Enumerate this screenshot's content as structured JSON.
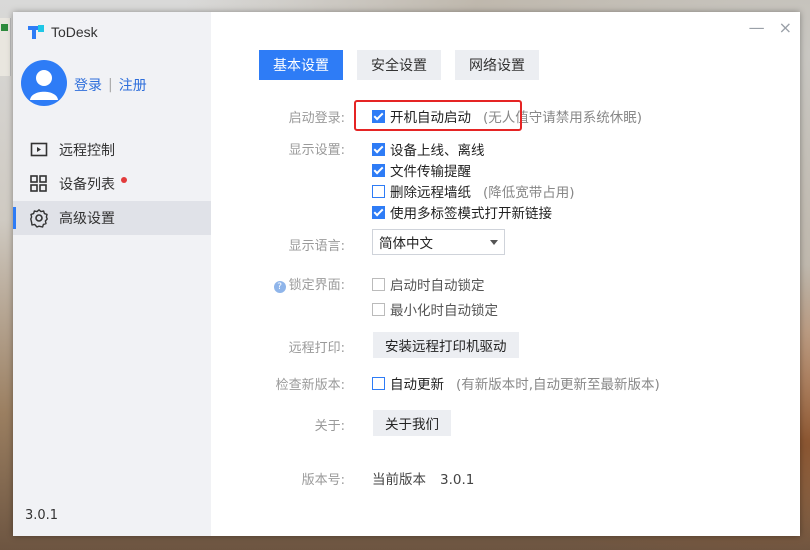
{
  "app": {
    "title": "ToDesk",
    "version": "3.0.1"
  },
  "user": {
    "login_label": "登录",
    "separator": "|",
    "register_label": "注册"
  },
  "sidebar": {
    "items": [
      {
        "label": "远程控制",
        "icon": "remote-control-icon",
        "active": false
      },
      {
        "label": "设备列表",
        "icon": "device-list-icon",
        "active": false,
        "badge": "red-dot"
      },
      {
        "label": "高级设置",
        "icon": "gear-icon",
        "active": true
      }
    ]
  },
  "window_controls": {
    "minimize": "—",
    "close": "×"
  },
  "tabs": [
    {
      "label": "基本设置",
      "active": true
    },
    {
      "label": "安全设置",
      "active": false
    },
    {
      "label": "网络设置",
      "active": false
    }
  ],
  "settings": {
    "startup": {
      "label": "启动登录:",
      "option": "开机自动启动",
      "checked": true,
      "hint": "(无人值守请禁用系统休眠)"
    },
    "display": {
      "label": "显示设置:",
      "options": [
        {
          "label": "设备上线、离线",
          "checked": true
        },
        {
          "label": "文件传输提醒",
          "checked": true
        },
        {
          "label": "删除远程墙纸",
          "checked": false,
          "hint": "(降低宽带占用)"
        },
        {
          "label": "使用多标签模式打开新链接",
          "checked": true
        }
      ]
    },
    "language": {
      "label": "显示语言:",
      "value": "简体中文"
    },
    "lock": {
      "label": "锁定界面:",
      "options": [
        {
          "label": "启动时自动锁定",
          "checked": false
        },
        {
          "label": "最小化时自动锁定",
          "checked": false
        }
      ]
    },
    "print": {
      "label": "远程打印:",
      "button": "安装远程打印机驱动"
    },
    "update": {
      "label": "检查新版本:",
      "option": "自动更新",
      "checked": false,
      "hint": "(有新版本时,自动更新至最新版本)"
    },
    "about": {
      "label": "关于:",
      "button": "关于我们"
    },
    "version": {
      "label": "版本号:",
      "prefix": "当前版本",
      "value": "3.0.1"
    }
  },
  "colors": {
    "accent": "#2e7cf6",
    "highlight": "#e52424",
    "badge": "#e23b3b"
  }
}
